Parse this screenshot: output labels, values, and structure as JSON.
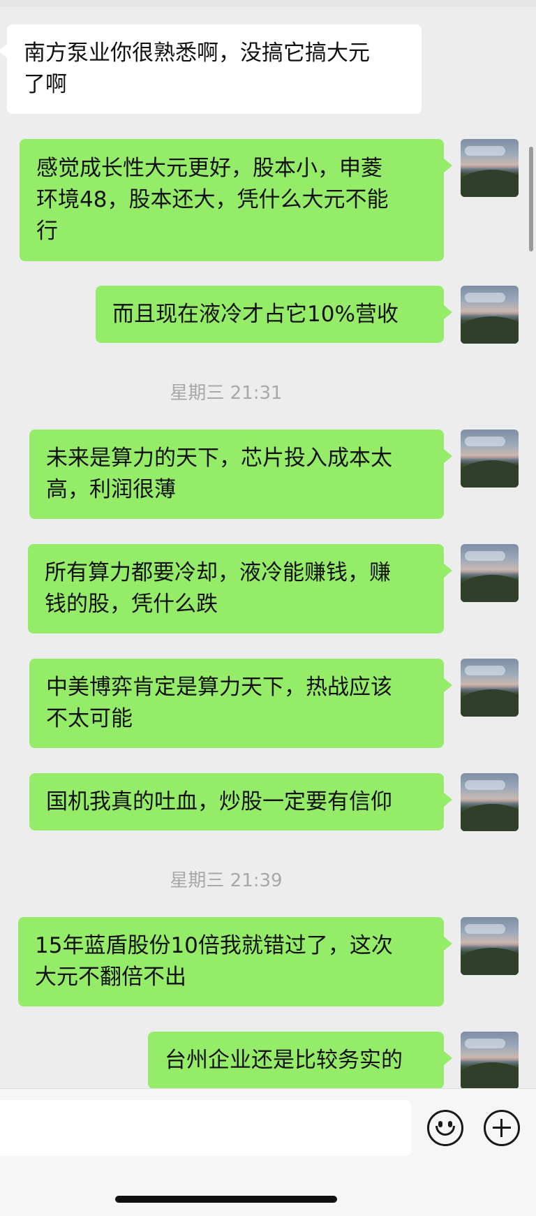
{
  "messages": [
    {
      "side": "in",
      "lines": [
        "南方泵业你很熟悉啊，没搞它搞大元",
        "了啊"
      ]
    },
    {
      "side": "out",
      "lines": [
        "感觉成长性大元更好，股本小，申菱",
        "环境48，股本还大，凭什么大元不能",
        "行"
      ]
    },
    {
      "side": "out",
      "lines": [
        "而且现在液冷才占它10%营收"
      ]
    },
    {
      "timestamp": "星期三 21:31"
    },
    {
      "side": "out",
      "lines": [
        "未来是算力的天下，芯片投入成本太",
        "高，利润很薄"
      ]
    },
    {
      "side": "out",
      "lines": [
        "所有算力都要冷却，液冷能赚钱，赚",
        "钱的股，凭什么跌"
      ]
    },
    {
      "side": "out",
      "lines": [
        "中美博弈肯定是算力天下，热战应该",
        "不太可能"
      ]
    },
    {
      "side": "out",
      "lines": [
        "国机我真的吐血，炒股一定要有信仰"
      ]
    },
    {
      "timestamp": "星期三 21:39"
    },
    {
      "side": "out",
      "lines": [
        "15年蓝盾股份10倍我就错过了，这次",
        "大元不翻倍不出"
      ]
    },
    {
      "side": "out",
      "lines": [
        "台州企业还是比较务实的"
      ]
    }
  ],
  "input": {
    "value": ""
  },
  "icons": {
    "emoji": "smiley-icon",
    "more": "plus-circle-icon"
  },
  "colors": {
    "outgoing_bubble": "#95ec69",
    "incoming_bubble": "#ffffff",
    "background": "#ededed"
  }
}
